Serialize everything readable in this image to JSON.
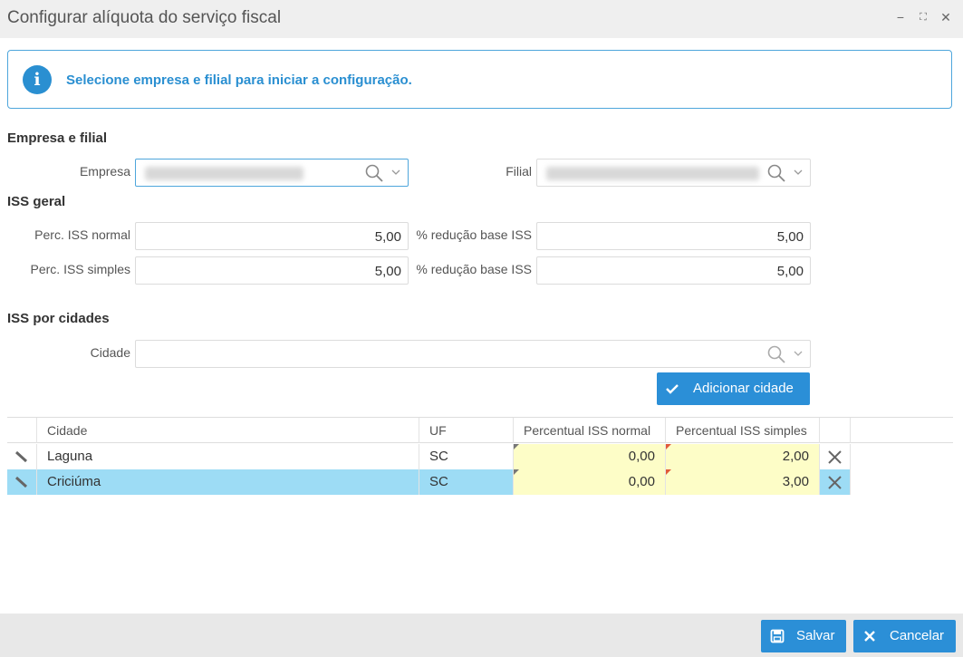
{
  "window": {
    "title": "Configurar alíquota do serviço fiscal",
    "controls": {
      "minimize": "−",
      "maximize": "⛶",
      "close": "✕"
    }
  },
  "info": {
    "message": "Selecione empresa e filial para iniciar a configuração."
  },
  "empresa_filial": {
    "section_title": "Empresa e filial",
    "empresa_label": "Empresa",
    "filial_label": "Filial"
  },
  "iss_geral": {
    "section_title": "ISS geral",
    "perc_normal_label": "Perc. ISS normal",
    "perc_normal_value": "5,00",
    "reducao_normal_label": "% redução base ISS",
    "reducao_normal_value": "5,00",
    "perc_simples_label": "Perc. ISS simples",
    "perc_simples_value": "5,00",
    "reducao_simples_label": "% redução base ISS",
    "reducao_simples_value": "5,00"
  },
  "iss_cidades": {
    "section_title": "ISS por cidades",
    "cidade_label": "Cidade",
    "add_button": "Adicionar cidade"
  },
  "table": {
    "columns": [
      "Cidade",
      "UF",
      "Percentual ISS normal",
      "Percentual ISS simples"
    ],
    "rows": [
      {
        "cidade": "Laguna",
        "uf": "SC",
        "iss_normal": "0,00",
        "iss_simples": "2,00",
        "selected": false
      },
      {
        "cidade": "Criciúma",
        "uf": "SC",
        "iss_normal": "0,00",
        "iss_simples": "3,00",
        "selected": true
      }
    ]
  },
  "footer": {
    "save": "Salvar",
    "cancel": "Cancelar"
  },
  "colors": {
    "accent": "#2b8fd7",
    "selected_row": "#9ddcf5",
    "edit_cell": "#fdfdc7",
    "info_border": "#4ea6dc"
  }
}
